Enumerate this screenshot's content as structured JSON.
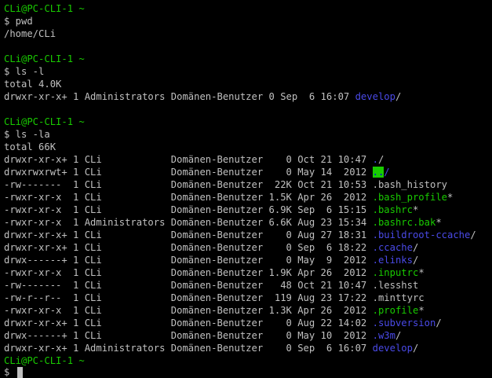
{
  "prompt": "CLi@PC-CLI-1 ~",
  "commands": {
    "pwd": "$ pwd",
    "ls_l": "$ ls -l",
    "ls_la": "$ ls -la",
    "final": "$ "
  },
  "outputs": {
    "pwd_result": "/home/CLi",
    "ls_l_total": "total 4.0K",
    "ls_la_total": "total 66K"
  },
  "ls_l_rows": [
    {
      "meta": "drwxr-xr-x+ 1 Administrators Domänen-Benutzer 0 Sep  6 16:07 ",
      "name": "develop",
      "suffix": "/",
      "kind": "dir"
    }
  ],
  "ls_la_rows": [
    {
      "meta": "drwxr-xr-x+ 1 CLi            Domänen-Benutzer    0 Oct 21 10:47 ",
      "name": ".",
      "suffix": "/",
      "kind": "dir"
    },
    {
      "meta": "drwxrwxrwt+ 1 CLi            Domänen-Benutzer    0 May 14  2012 ",
      "name": "..",
      "suffix": "/",
      "kind": "dir-hl"
    },
    {
      "meta": "-rw-------  1 CLi            Domänen-Benutzer  22K Oct 21 10:53 ",
      "name": ".bash_history",
      "suffix": "",
      "kind": "file"
    },
    {
      "meta": "-rwxr-xr-x  1 CLi            Domänen-Benutzer 1.5K Apr 26  2012 ",
      "name": ".bash_profile",
      "suffix": "*",
      "kind": "exec"
    },
    {
      "meta": "-rwxr-xr-x  1 CLi            Domänen-Benutzer 6.9K Sep  6 15:15 ",
      "name": ".bashrc",
      "suffix": "*",
      "kind": "exec"
    },
    {
      "meta": "-rwxr-xr-x  1 Administrators Domänen-Benutzer 6.6K Aug 23 15:34 ",
      "name": ".bashrc.bak",
      "suffix": "*",
      "kind": "exec"
    },
    {
      "meta": "drwxr-xr-x+ 1 CLi            Domänen-Benutzer    0 Aug 27 18:31 ",
      "name": ".buildroot-ccache",
      "suffix": "/",
      "kind": "dir"
    },
    {
      "meta": "drwxr-xr-x+ 1 CLi            Domänen-Benutzer    0 Sep  6 18:22 ",
      "name": ".ccache",
      "suffix": "/",
      "kind": "dir"
    },
    {
      "meta": "drwx------+ 1 CLi            Domänen-Benutzer    0 May  9  2012 ",
      "name": ".elinks",
      "suffix": "/",
      "kind": "dir"
    },
    {
      "meta": "-rwxr-xr-x  1 CLi            Domänen-Benutzer 1.9K Apr 26  2012 ",
      "name": ".inputrc",
      "suffix": "*",
      "kind": "exec"
    },
    {
      "meta": "-rw-------  1 CLi            Domänen-Benutzer   48 Oct 21 10:47 ",
      "name": ".lesshst",
      "suffix": "",
      "kind": "file"
    },
    {
      "meta": "-rw-r--r--  1 CLi            Domänen-Benutzer  119 Aug 23 17:22 ",
      "name": ".minttyrc",
      "suffix": "",
      "kind": "file"
    },
    {
      "meta": "-rwxr-xr-x  1 CLi            Domänen-Benutzer 1.3K Apr 26  2012 ",
      "name": ".profile",
      "suffix": "*",
      "kind": "exec"
    },
    {
      "meta": "drwxr-xr-x+ 1 CLi            Domänen-Benutzer    0 Aug 22 14:02 ",
      "name": ".subversion",
      "suffix": "/",
      "kind": "dir"
    },
    {
      "meta": "drwx------+ 1 CLi            Domänen-Benutzer    0 May 10  2012 ",
      "name": ".w3m",
      "suffix": "/",
      "kind": "dir"
    },
    {
      "meta": "drwxr-xr-x+ 1 Administrators Domänen-Benutzer    0 Sep  6 16:07 ",
      "name": "develop",
      "suffix": "/",
      "kind": "dir"
    }
  ],
  "colors": {
    "background": "#000000",
    "text": "#c0c0c0",
    "prompt": "#19cb00",
    "directory": "#4a4ae8",
    "executable": "#19cb00"
  }
}
